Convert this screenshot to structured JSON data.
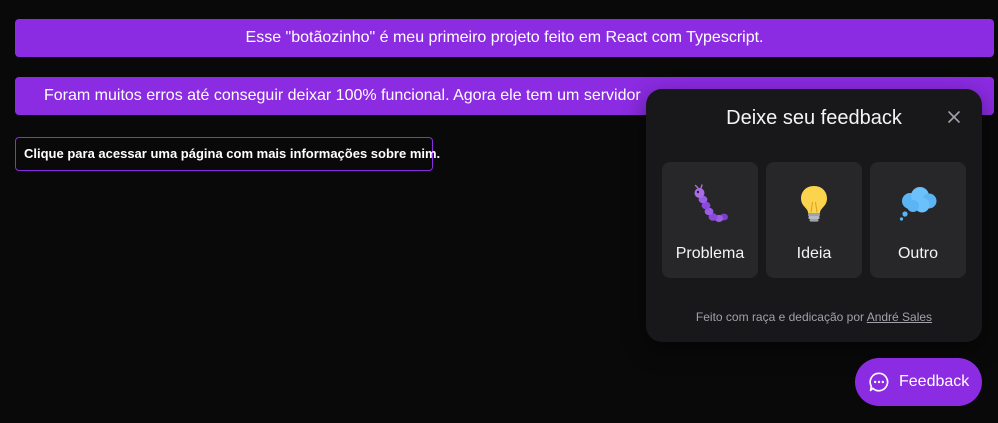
{
  "banners": {
    "first": "Esse \"botãozinho\" é meu primeiro projeto feito em React com Typescript.",
    "second": "Foram muitos erros até conseguir deixar 100% funcional. Agora ele tem um servidor"
  },
  "info_link": "Clique para acessar uma página com mais informações sobre mim.",
  "widget": {
    "title": "Deixe seu feedback",
    "options": [
      {
        "label": "Problema",
        "icon": "bug-icon"
      },
      {
        "label": "Ideia",
        "icon": "lightbulb-icon"
      },
      {
        "label": "Outro",
        "icon": "thought-cloud-icon"
      }
    ],
    "footer_prefix": "Feito com raça e dedicação por ",
    "footer_author": "André Sales"
  },
  "fab": {
    "label": "Feedback",
    "icon": "chat-icon"
  },
  "colors": {
    "accent": "#8b2be2",
    "background": "#09090a",
    "surface": "#18181b",
    "surface_secondary": "#27272a"
  }
}
